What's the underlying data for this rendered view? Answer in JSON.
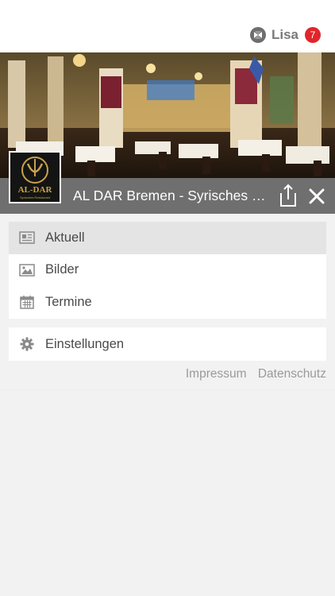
{
  "header": {
    "username": "Lisa",
    "notification_count": "7",
    "app_icon": "app-logo-icon"
  },
  "business": {
    "title": "AL DAR Bremen - Syrisches Restaurant",
    "logo_text": "AL-DAR",
    "logo_subtext": "Syrisches Restaurant",
    "share_icon": "share-icon",
    "close_icon": "close-icon"
  },
  "menu": {
    "items": [
      {
        "label": "Aktuell",
        "icon": "newspaper-icon",
        "active": true
      },
      {
        "label": "Bilder",
        "icon": "image-icon",
        "active": false
      },
      {
        "label": "Termine",
        "icon": "calendar-icon",
        "active": false
      }
    ],
    "settings": {
      "label": "Einstellungen",
      "icon": "gear-icon"
    }
  },
  "footer": {
    "impressum": "Impressum",
    "datenschutz": "Datenschutz"
  },
  "colors": {
    "badge": "#e0262b",
    "titlebar": "#6f6f6f",
    "active_item": "#e4e4e4",
    "background": "#f2f2f2"
  }
}
